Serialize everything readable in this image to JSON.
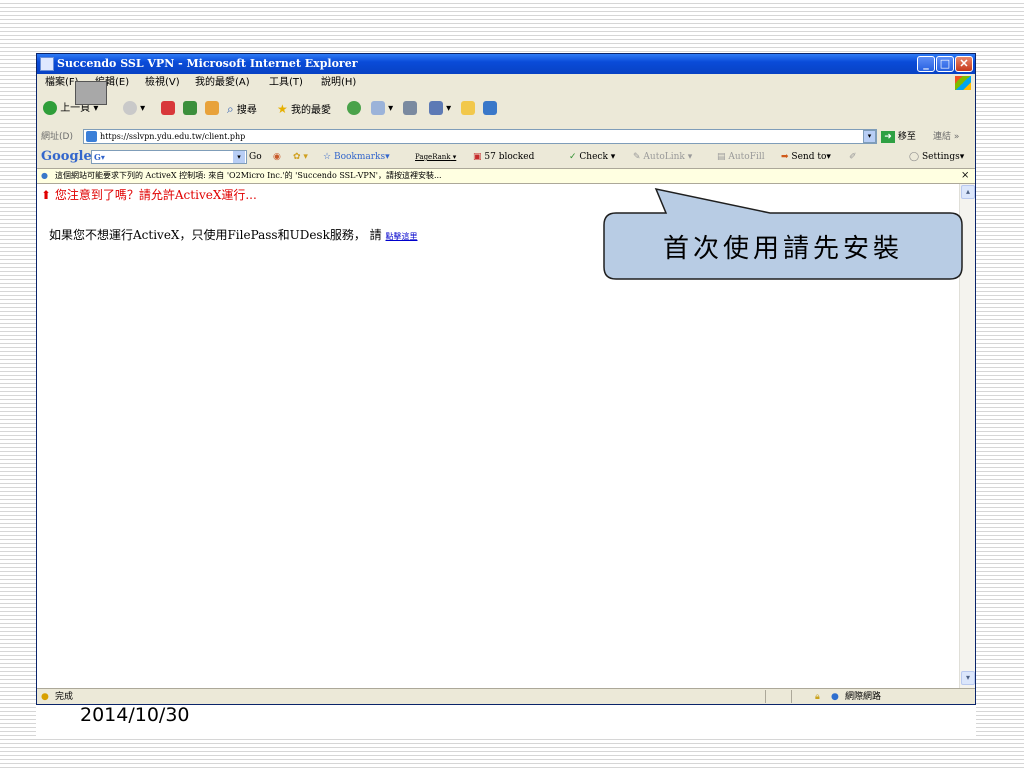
{
  "window": {
    "title": "Succendo SSL VPN - Microsoft Internet Explorer",
    "min_label": "_",
    "max_label": "□",
    "close_label": "✕"
  },
  "menu": [
    "檔案(F)",
    "編輯(E)",
    "檢視(V)",
    "我的最愛(A)",
    "工具(T)",
    "說明(H)"
  ],
  "toolbar": {
    "back_label": "上一頁",
    "search_label": "搜尋",
    "favorites_label": "我的最愛"
  },
  "address": {
    "label": "網址(D)",
    "url": "https://sslvpn.ydu.edu.tw/client.php",
    "go_label": "移至",
    "links_label": "連結"
  },
  "googlebar": {
    "logo": "Google",
    "go_label": "Go",
    "bookmarks_label": "Bookmarks",
    "pagerank_label": "PageRank",
    "blocked_label": "57 blocked",
    "check_label": "Check",
    "autolink_label": "AutoLink",
    "autofill_label": "AutoFill",
    "sendto_label": "Send to",
    "settings_label": "Settings"
  },
  "infobar": {
    "text": "這個網站可能要求下列的 ActiveX 控制項: 來自 'O2Micro Inc.'的 'Succendo SSL-VPN'，請按這裡安裝...",
    "close_label": "×"
  },
  "content": {
    "warning": "您注意到了嗎？請允許ActiveX運行...",
    "message": "如果您不想運行ActiveX，只使用FilePass和UDesk服務，  請",
    "link": "點擊這里"
  },
  "callout": {
    "text": "首次使用請先安裝"
  },
  "status": {
    "text": "完成",
    "zone": "網際網路"
  },
  "slide": {
    "date": "2014/10/30"
  },
  "colors": {
    "titlebar": "#0a4bd8",
    "warning": "#e00000",
    "link": "#0000cc",
    "infobar": "#ffffe1"
  }
}
